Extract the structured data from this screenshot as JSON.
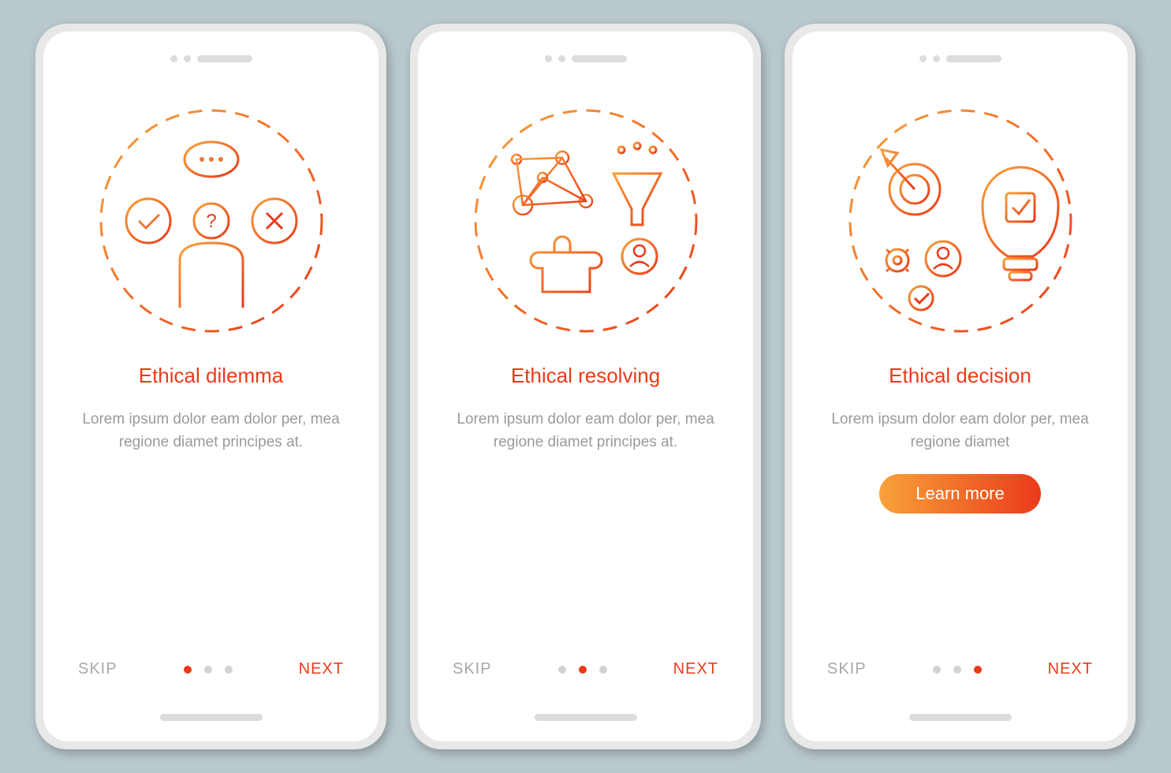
{
  "screens": [
    {
      "title": "Ethical dilemma",
      "body": "Lorem ipsum dolor eam dolor per, mea regione diamet principes at.",
      "skip": "SKIP",
      "next": "NEXT",
      "active_dot": 0,
      "icon": "dilemma-icon",
      "has_cta": false
    },
    {
      "title": "Ethical resolving",
      "body": "Lorem ipsum dolor eam dolor per, mea regione diamet principes at.",
      "skip": "SKIP",
      "next": "NEXT",
      "active_dot": 1,
      "icon": "resolving-icon",
      "has_cta": false
    },
    {
      "title": "Ethical decision",
      "body": "Lorem ipsum dolor eam dolor per, mea regione diamet",
      "skip": "SKIP",
      "next": "NEXT",
      "active_dot": 2,
      "icon": "decision-icon",
      "has_cta": true,
      "cta_label": "Learn more"
    }
  ],
  "colors": {
    "accent": "#ea3a1a",
    "accent_light": "#f8a23a",
    "muted": "#9a9a9a"
  }
}
